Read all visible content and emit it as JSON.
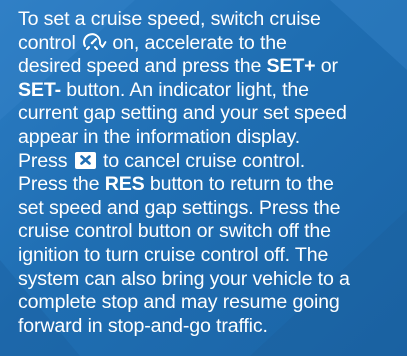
{
  "text": {
    "l1": "To set a cruise speed, switch cruise",
    "l2a": "control",
    "l2b": "on, accelerate to the",
    "l3": "desired speed and press the",
    "l3_set_plus": "SET+",
    "l3_or": "or",
    "l4_set_minus": "SET-",
    "l4b": "button. An indicator light, the",
    "l5": "current gap setting and your set speed",
    "l6": "appear in the information display.",
    "l7a": "Press",
    "l7b": "to cancel cruise control.",
    "l8a": "Press the",
    "l8_res": "RES",
    "l8b": "button to return to the",
    "l9": "set speed and gap settings. Press the",
    "l10": "cruise control button or switch off the",
    "l11": "ignition to turn cruise control off. The",
    "l12": "system can also bring your vehicle to a",
    "l13": "complete stop and may resume going",
    "l14": "forward in stop-and-go traffic."
  },
  "icons": {
    "cruise_control": "cruise-control-icon",
    "cancel": "cancel-x-icon"
  },
  "colors": {
    "background": "#1f6eb3",
    "text": "#ffffff"
  }
}
